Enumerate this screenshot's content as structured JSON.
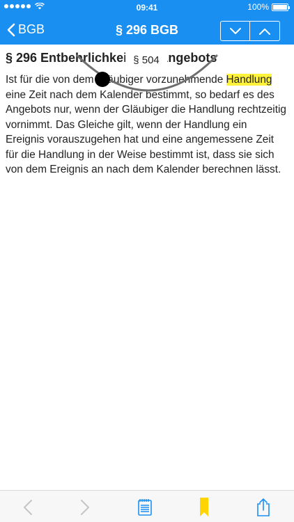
{
  "status": {
    "time": "09:41",
    "battery": "100%"
  },
  "header": {
    "back_label": "BGB",
    "title": "§ 296 BGB"
  },
  "article": {
    "title": "§ 296 Entbehrlichkeit des Angebots",
    "body_before": "Ist für die von dem Gläubiger vorzunehmende ",
    "highlight": "Handlung",
    "body_after": " eine Zeit nach dem Kalender bestimmt, so bedarf es des Angebots nur, wenn der Gläubiger die Handlung rechtzeitig vornimmt. Das Gleiche gilt, wenn der Handlung ein Ereignis vorauszugehen hat und eine angemessene Zeit für die Handlung in der Weise bestimmt ist, dass sie sich von dem Ereignis an nach dem Kalender berechnen lässt."
  },
  "scrubber": {
    "label": "§ 504"
  },
  "toolbar": {
    "icons": [
      "chevron-left-icon",
      "chevron-right-icon",
      "notes-icon",
      "bookmark-icon",
      "share-icon"
    ],
    "colors": {
      "accent": "#1a8ff2",
      "bookmark": "#ffd400"
    }
  }
}
